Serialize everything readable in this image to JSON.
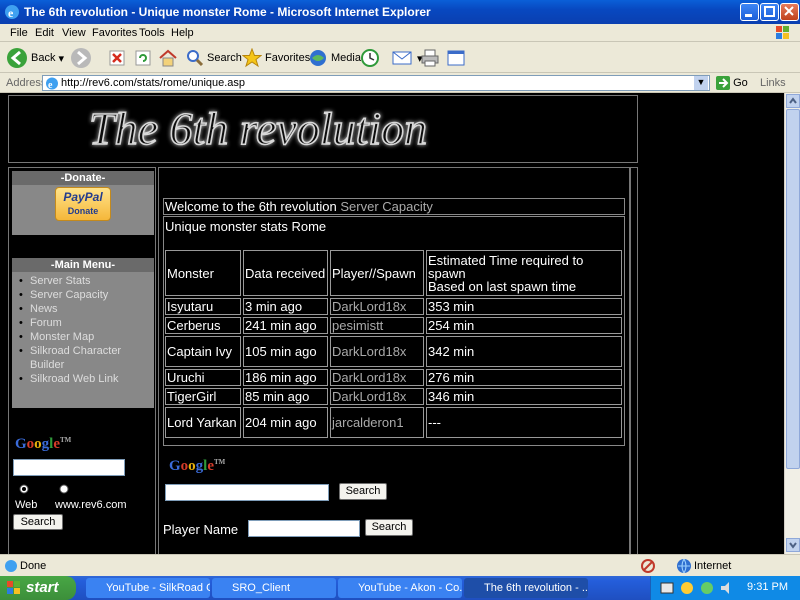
{
  "window": {
    "title": "The 6th revolution - Unique monster Rome - Microsoft Internet Explorer"
  },
  "menubar": {
    "items": [
      "File",
      "Edit",
      "View",
      "Favorites",
      "Tools",
      "Help"
    ]
  },
  "toolbar": {
    "back": "Back",
    "search": "Search",
    "favorites": "Favorites",
    "media": "Media"
  },
  "address": {
    "label": "Address",
    "url": "http://rev6.com/stats/rome/unique.asp",
    "go": "Go",
    "links": "Links"
  },
  "site": {
    "banner_text": "The 6th revolution",
    "donate": {
      "header": "-Donate-",
      "paypal": "PayPal",
      "paypal_sub": "Donate"
    },
    "main_menu": {
      "header": "-Main Menu-",
      "items": [
        "Server Stats",
        "Server Capacity",
        "News",
        "Forum",
        "Monster Map",
        "Silkroad Character Builder",
        "Silkroad Web Link"
      ]
    },
    "google_left": {
      "web": "Web",
      "site": "www.rev6.com",
      "search": "Search"
    },
    "welcome": "Welcome  to the 6th revolution",
    "server_capacity_link": "Server Capacity",
    "subtitle": "Unique monster stats Rome",
    "table": {
      "headers": [
        "Monster",
        "Data received",
        "Player//Spawn",
        "Estimated Time required to spawn",
        "Based on last spawn time"
      ],
      "rows": [
        [
          "Isyutaru",
          "3 min ago",
          "DarkLord18x",
          "353 min"
        ],
        [
          "Cerberus",
          "241 min ago",
          "pesimistt",
          "254 min"
        ],
        [
          "Captain Ivy",
          "105 min ago",
          "DarkLord18x",
          "342 min"
        ],
        [
          "Uruchi",
          "186 min ago",
          "DarkLord18x",
          "276 min"
        ],
        [
          "TigerGirl",
          "85 min ago",
          "DarkLord18x",
          "346 min"
        ],
        [
          "Lord Yarkan",
          "204 min ago",
          "jarcalderon1",
          "---"
        ]
      ]
    },
    "google_main": {
      "search": "Search"
    },
    "player_search": {
      "label": "Player Name",
      "button": "Search"
    }
  },
  "statusbar": {
    "status": "Done",
    "zone": "Internet"
  },
  "taskbar": {
    "start": "start",
    "tasks": [
      "YouTube - SilkRoad O...",
      "SRO_Client",
      "YouTube - Akon - Co...",
      "The 6th revolution - ..."
    ],
    "clock": "9:31 PM"
  }
}
